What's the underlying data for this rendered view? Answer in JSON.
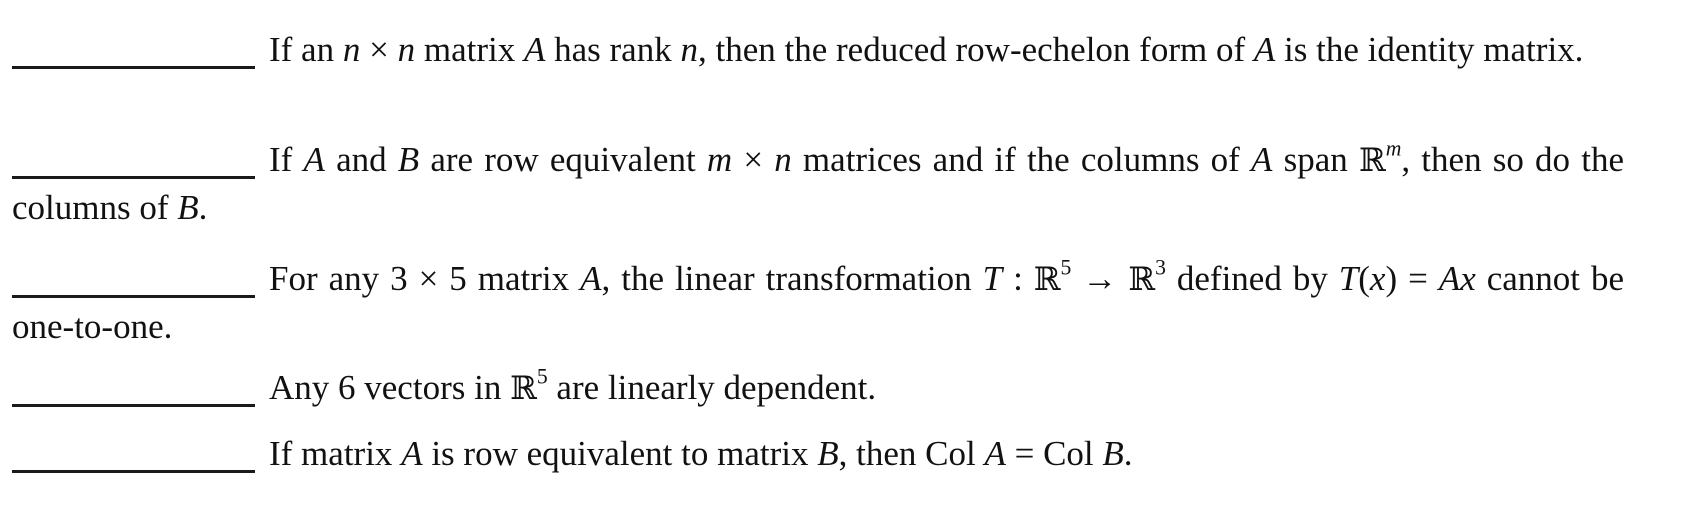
{
  "document": {
    "items": [
      {
        "blank_value": "",
        "statement": {
          "p1": "If an ",
          "m1": "n",
          "p2": " × ",
          "m2": "n",
          "p3": " matrix ",
          "m3": "A",
          "p4": " has rank ",
          "m4": "n",
          "p5": ", then the reduced row-echelon form of ",
          "m5": "A",
          "p6": " is the identity matrix."
        }
      },
      {
        "blank_value": "",
        "statement": {
          "p1": "If ",
          "m1": "A",
          "p2": " and ",
          "m2": "B",
          "p3": " are row equivalent ",
          "m3": "m",
          "p4": " × ",
          "m4": "n",
          "p5": " matrices and if the columns of ",
          "m5": "A",
          "p6": " span ",
          "bb1": "ℝ",
          "sup1": "m",
          "p7": ", then so do the columns of ",
          "m6": "B",
          "p8": "."
        }
      },
      {
        "blank_value": "",
        "statement": {
          "p1": "For any 3 × 5 matrix ",
          "m1": "A",
          "p2": ", the linear transformation ",
          "m2": "T",
          "p3": " : ",
          "bb1": "ℝ",
          "sup1": "5",
          "p4": " → ",
          "bb2": "ℝ",
          "sup2": "3",
          "p5": " defined by ",
          "m3": "T",
          "p6": "(",
          "m4": "x",
          "p7": ") = ",
          "m5": "Ax",
          "p8": " cannot be one-to-one."
        }
      },
      {
        "blank_value": "",
        "statement": {
          "p1": "Any 6 vectors in ",
          "bb1": "ℝ",
          "sup1": "5",
          "p2": " are linearly dependent."
        }
      },
      {
        "blank_value": "",
        "statement": {
          "p1": "If matrix ",
          "m1": "A",
          "p2": " is row equivalent to matrix ",
          "m2": "B",
          "p3": ", then Col ",
          "m3": "A",
          "p4": " = Col ",
          "m4": "B",
          "p5": "."
        }
      }
    ]
  }
}
